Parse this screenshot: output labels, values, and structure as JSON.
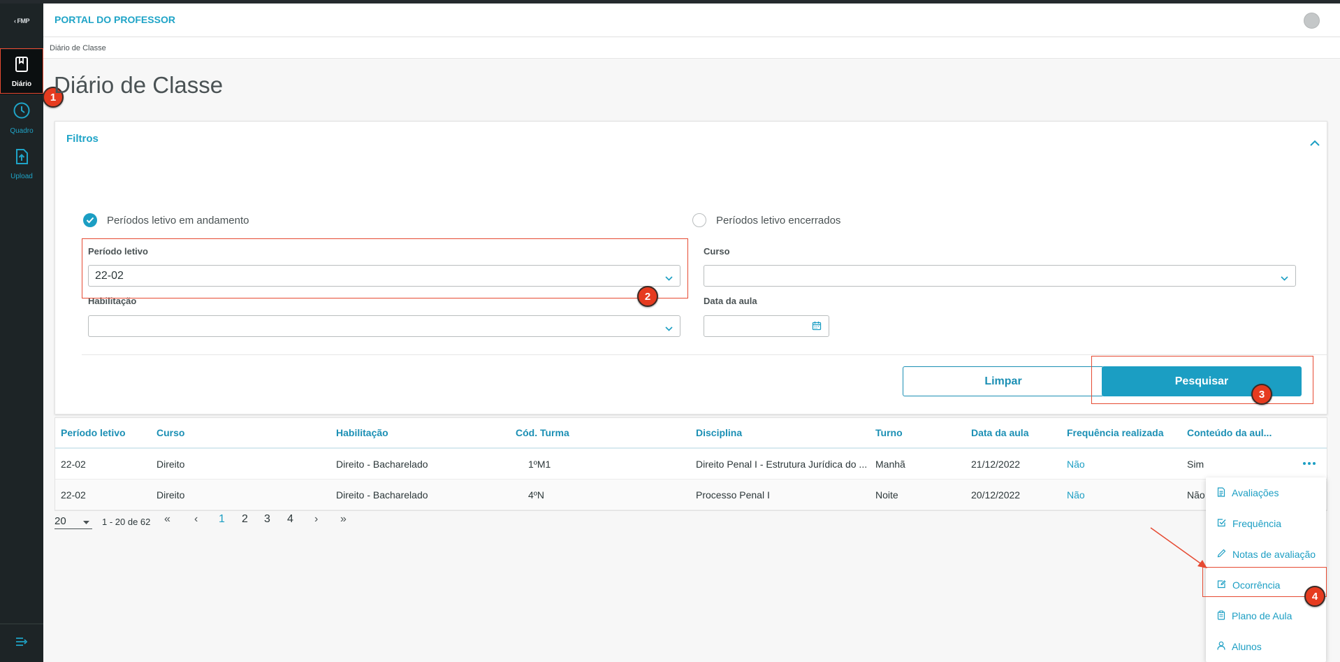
{
  "sidebar": {
    "logo": "FMP",
    "items": [
      {
        "label": "Diário",
        "icon": "book-icon",
        "active": true
      },
      {
        "label": "Quadro",
        "icon": "clock-icon",
        "active": false
      },
      {
        "label": "Upload",
        "icon": "upload-file-icon",
        "active": false
      }
    ],
    "collapse_icon": "collapse-menu-icon"
  },
  "header": {
    "title": "PORTAL DO PROFESSOR"
  },
  "breadcrumb": "Diário de Classe",
  "page_title": "Diário de Classe",
  "filters": {
    "title": "Filtros",
    "radio_active": "Períodos letivo em andamento",
    "radio_closed": "Períodos letivo encerrados",
    "periodo_label": "Período letivo",
    "periodo_value": "22-02",
    "curso_label": "Curso",
    "curso_value": "",
    "habilitacao_label": "Habilitação",
    "habilitacao_value": "",
    "data_label": "Data da aula",
    "data_value": "",
    "clear_button": "Limpar",
    "search_button": "Pesquisar"
  },
  "table": {
    "columns": [
      "Período letivo",
      "Curso",
      "Habilitação",
      "Cód. Turma",
      "Disciplina",
      "Turno",
      "Data da aula",
      "Frequência realizada",
      "Conteúdo da aul..."
    ],
    "rows": [
      [
        "22-02",
        "Direito",
        "Direito - Bacharelado",
        "1ºM1",
        "Direito Penal I - Estrutura Jurídica do ...",
        "Manhã",
        "21/12/2022",
        "Não",
        "Sim"
      ],
      [
        "22-02",
        "Direito",
        "Direito - Bacharelado",
        "4ºN",
        "Processo Penal I",
        "Noite",
        "20/12/2022",
        "Não",
        "Não"
      ]
    ]
  },
  "pagination": {
    "page_size": "20",
    "range": "1 - 20 de 62",
    "pages": [
      "1",
      "2",
      "3",
      "4"
    ],
    "current": "1"
  },
  "context_menu": [
    {
      "label": "Avaliações",
      "icon": "document-icon"
    },
    {
      "label": "Frequência",
      "icon": "checkbox-icon"
    },
    {
      "label": "Notas de avaliação",
      "icon": "pencil-icon"
    },
    {
      "label": "Ocorrência",
      "icon": "note-edit-icon"
    },
    {
      "label": "Plano de Aula",
      "icon": "clipboard-icon"
    },
    {
      "label": "Alunos",
      "icon": "user-icon"
    }
  ],
  "annotations": [
    "1",
    "2",
    "3",
    "4"
  ],
  "colors": {
    "accent": "#1b9ec3",
    "sidebar": "#1d2426",
    "annotation": "#e63b1f"
  }
}
